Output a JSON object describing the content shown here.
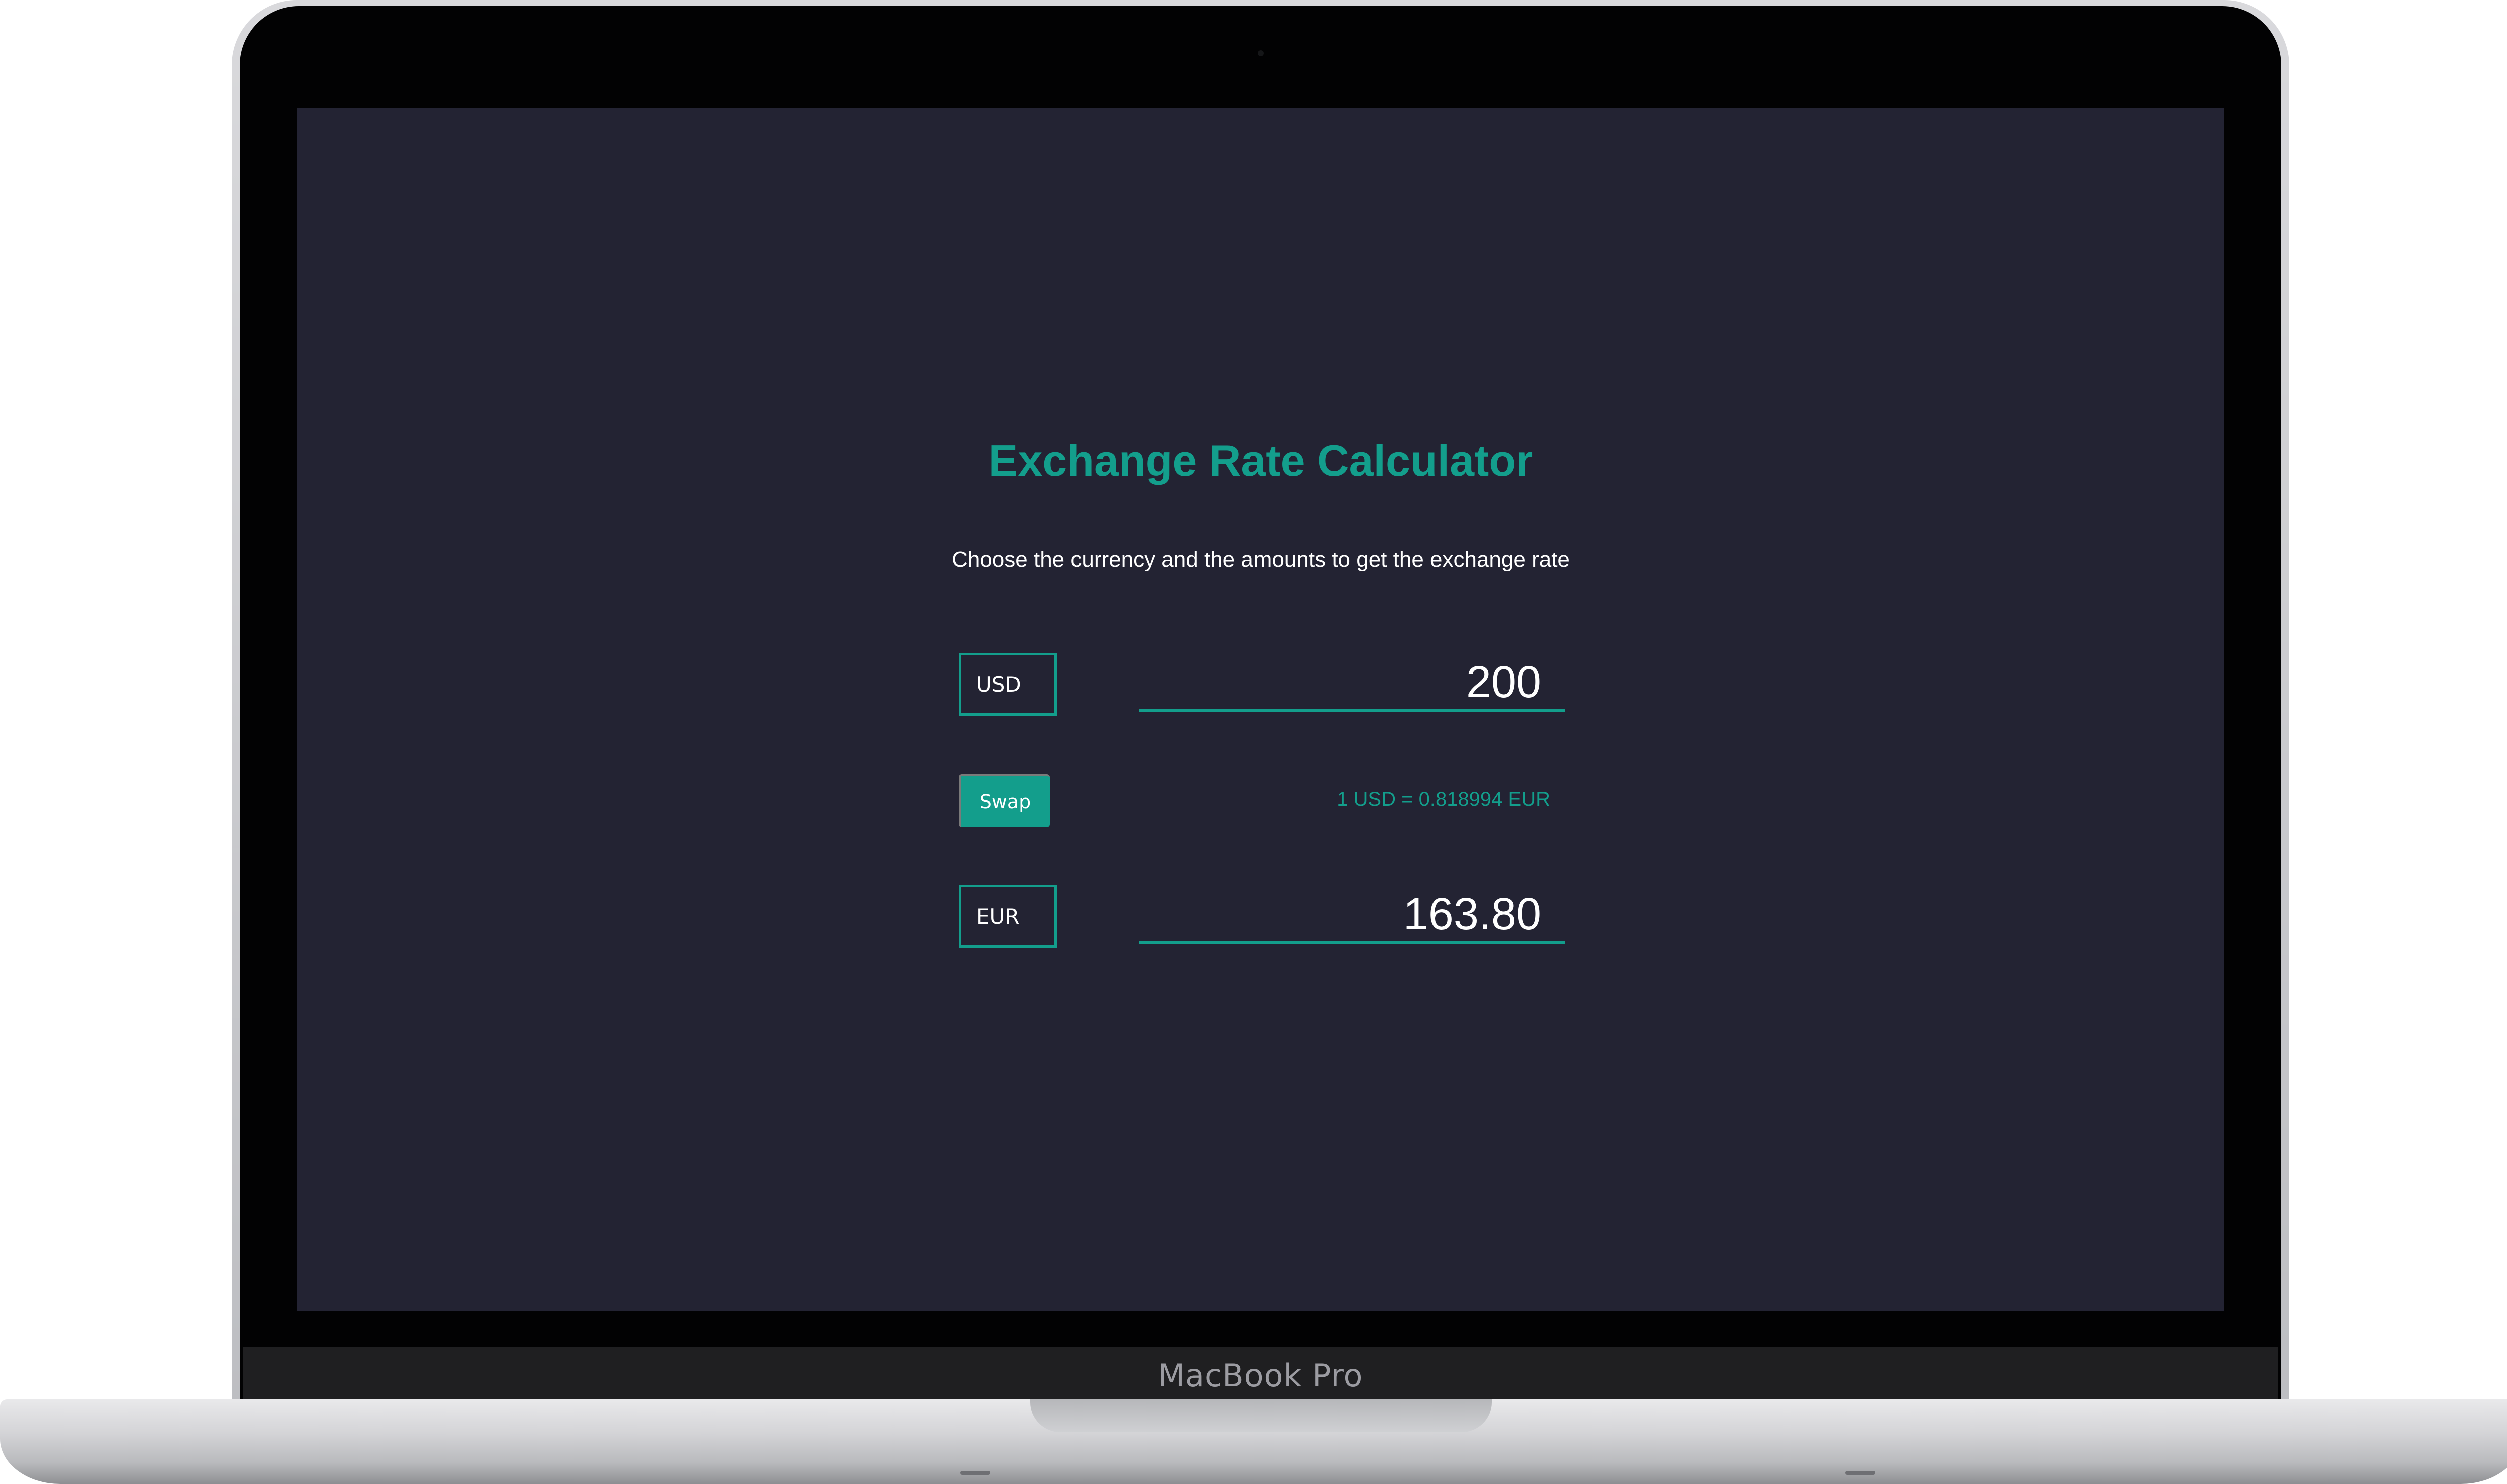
{
  "device": {
    "brand": "MacBook Pro"
  },
  "app": {
    "title": "Exchange Rate Calculator",
    "subtitle": "Choose the currency and the amounts to get the exchange rate",
    "from_currency": "USD",
    "from_amount": "200",
    "swap_label": "Swap",
    "rate_text": "1 USD = 0.818994 EUR",
    "to_currency": "EUR",
    "to_amount": "163.80"
  },
  "colors": {
    "accent": "#139e8c",
    "background": "#232333",
    "text": "#ffffff"
  }
}
